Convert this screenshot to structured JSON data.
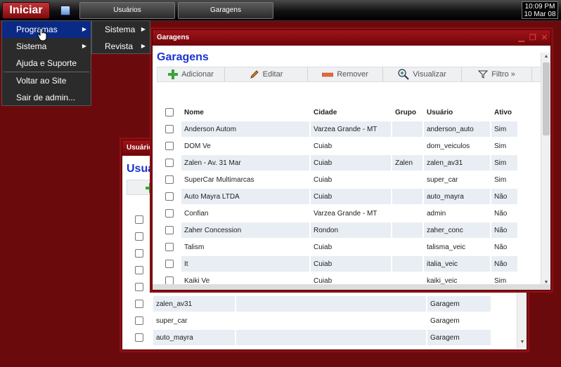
{
  "taskbar": {
    "start_label": "Iniciar",
    "tasks": [
      "Usuários",
      "Garagens"
    ],
    "clock_time": "10:09 PM",
    "clock_date": "10 Mar 08"
  },
  "start_menu": {
    "items": [
      {
        "label": "Programas"
      },
      {
        "label": "Sistema"
      },
      {
        "label": "Ajuda e Suporte"
      },
      {
        "label": "Voltar ao Site"
      },
      {
        "label": "Sair de admin..."
      }
    ],
    "submenu": [
      "Sistema",
      "Revista"
    ]
  },
  "usuarios_window": {
    "title": "Usuários",
    "heading": "Usuá",
    "rows": [
      {
        "col1": "",
        "col2": ""
      },
      {
        "col1": "",
        "col2": ""
      },
      {
        "col1": "",
        "col2": ""
      },
      {
        "col1": "",
        "col2": ""
      },
      {
        "col1": "",
        "col2": ""
      },
      {
        "col1": "zalen_av31",
        "col2": "Garagem"
      },
      {
        "col1": "super_car",
        "col2": "Garagem"
      },
      {
        "col1": "auto_mayra",
        "col2": "Garagem"
      }
    ]
  },
  "garagens_window": {
    "title": "Garagens",
    "heading": "Garagens",
    "toolbar": {
      "add": "Adicionar",
      "edit": "Editar",
      "remove": "Remover",
      "view": "Visualizar",
      "filter": "Filtro »"
    },
    "columns": [
      "Nome",
      "Cidade",
      "Grupo",
      "Usuário",
      "Ativo"
    ],
    "rows": [
      {
        "nome": "Anderson Autom",
        "cidade": "Varzea Grande - MT",
        "grupo": "",
        "usuario": "anderson_auto",
        "ativo": "Sim"
      },
      {
        "nome": "DOM Ve",
        "cidade": "Cuiab",
        "grupo": "",
        "usuario": "dom_veiculos",
        "ativo": "Sim"
      },
      {
        "nome": "Zalen - Av. 31 Mar",
        "cidade": "Cuiab",
        "grupo": "Zalen",
        "usuario": "zalen_av31",
        "ativo": "Sim"
      },
      {
        "nome": "SuperCar Multimarcas",
        "cidade": "Cuiab",
        "grupo": "",
        "usuario": "super_car",
        "ativo": "Sim"
      },
      {
        "nome": "Auto Mayra LTDA",
        "cidade": "Cuiab",
        "grupo": "",
        "usuario": "auto_mayra",
        "ativo": "Não"
      },
      {
        "nome": "Confian",
        "cidade": "Varzea Grande - MT",
        "grupo": "",
        "usuario": "admin",
        "ativo": "Não"
      },
      {
        "nome": "Zaher Concession",
        "cidade": "Rondon",
        "grupo": "",
        "usuario": "zaher_conc",
        "ativo": "Não"
      },
      {
        "nome": "Talism",
        "cidade": "Cuiab",
        "grupo": "",
        "usuario": "talisma_veic",
        "ativo": "Não"
      },
      {
        "nome": "It",
        "cidade": "Cuiab",
        "grupo": "",
        "usuario": "italia_veic",
        "ativo": "Não"
      },
      {
        "nome": "Kaiki Ve",
        "cidade": "Cuiab",
        "grupo": "",
        "usuario": "kaiki_veic",
        "ativo": "Sim"
      }
    ]
  }
}
